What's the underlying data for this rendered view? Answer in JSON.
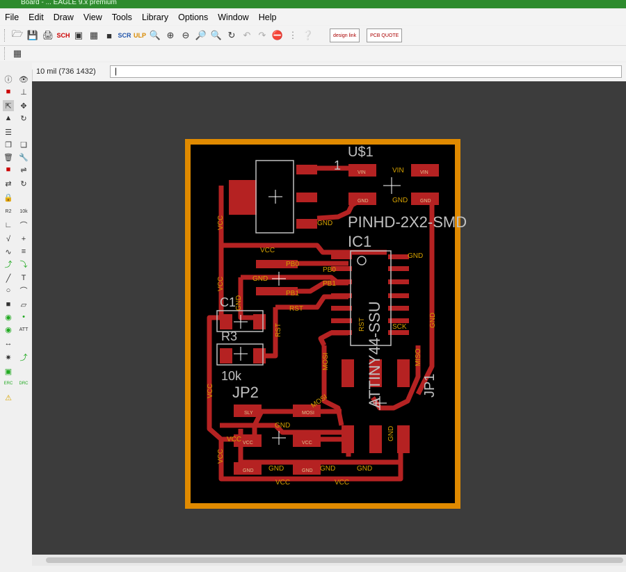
{
  "app": {
    "title": "Board - ... EAGLE 9.x premium"
  },
  "menu": [
    "File",
    "Edit",
    "Draw",
    "View",
    "Tools",
    "Library",
    "Options",
    "Window",
    "Help"
  ],
  "toolbar": {
    "designlink_label": "design link",
    "pcbquote_label": "PCB QUOTE"
  },
  "command": {
    "coordinate": "10 mil (736 1432)",
    "value": "|"
  },
  "board": {
    "parts": {
      "u1": {
        "name": "U$1",
        "package": "PINHD-2X2-SMD"
      },
      "ic1": {
        "name": "IC1",
        "value": "ATTINY44-SSU"
      },
      "c1": {
        "name": "C1"
      },
      "r3": {
        "name": "R3",
        "value": "10k"
      },
      "jp2": {
        "name": "JP2"
      },
      "jp1": {
        "name": "JP1"
      },
      "pin1": "1"
    },
    "labels": {
      "vcc": "VCC",
      "gnd": "GND",
      "vin": "VIN",
      "pb0": "PB0",
      "pb1": "PB1",
      "rst": "RST",
      "mosi": "MOSI",
      "miso": "MISO",
      "sck": "SCK",
      "sly": "SLY"
    },
    "colors": {
      "outline": "#e08a00",
      "copper": "#b52222",
      "background": "#000000",
      "silk": "#c0c0c0",
      "canvas": "#3c3c3c"
    }
  }
}
